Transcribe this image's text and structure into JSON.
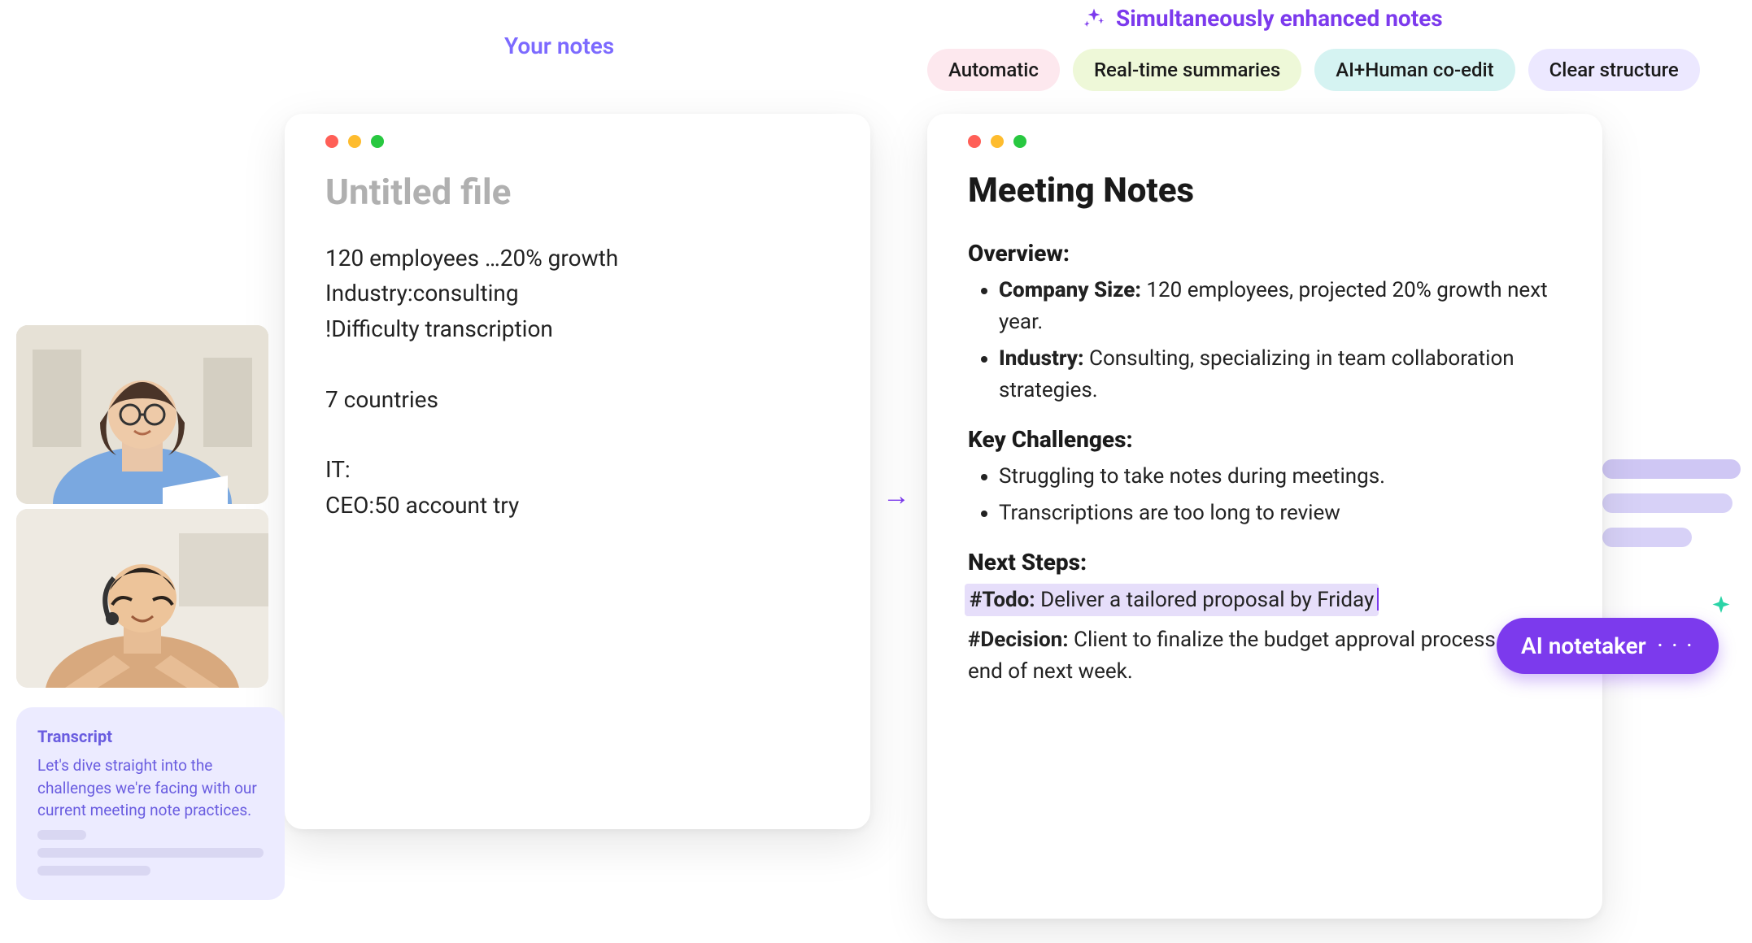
{
  "headers": {
    "your_notes": "Your notes",
    "enhanced": "Simultaneously enhanced notes"
  },
  "pills": {
    "automatic": "Automatic",
    "realtime": "Real-time summaries",
    "coedit": "AI+Human co-edit",
    "structure": "Clear structure"
  },
  "left_card": {
    "title": "Untitled file",
    "body": "120 employees …20% growth\nIndustry:consulting\n!Difficulty transcription\n\n7 countries\n\nIT:\nCEO:50 account try"
  },
  "right_card": {
    "title": "Meeting Notes",
    "overview_h": "Overview:",
    "overview_items": {
      "company_label": "Company Size:",
      "company_text": " 120 employees, projected 20% growth next year.",
      "industry_label": "Industry:",
      "industry_text": " Consulting, specializing in team collaboration strategies."
    },
    "challenges_h": "Key Challenges:",
    "challenges": {
      "c1": "Struggling to take notes during meetings.",
      "c2": "Transcriptions are too long to review"
    },
    "next_h": "Next Steps:",
    "todo_tag": "#Todo:",
    "todo_text": " Deliver a tailored proposal by Friday",
    "decision_tag": "#Decision:",
    "decision_text": " Client to finalize the budget approval process by end of next week."
  },
  "transcript": {
    "title": "Transcript",
    "body": "Let's dive straight into the challenges we're facing with our current meeting note practices."
  },
  "ai_badge": {
    "label": "AI notetaker",
    "dots": "· · ·"
  }
}
